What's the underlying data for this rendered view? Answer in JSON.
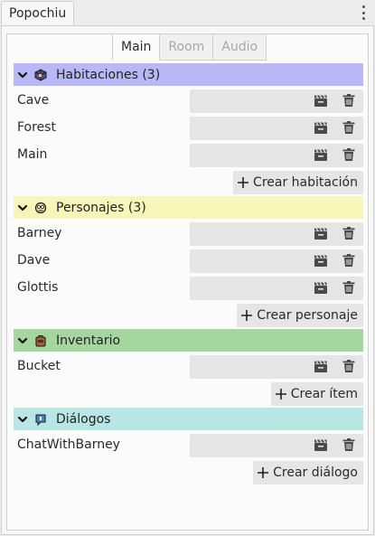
{
  "dock": {
    "title": "Popochiu"
  },
  "tabs": [
    {
      "label": "Main",
      "active": true
    },
    {
      "label": "Room",
      "active": false
    },
    {
      "label": "Audio",
      "active": false
    }
  ],
  "sections": [
    {
      "key": "rooms",
      "title": "Habitaciones (3)",
      "color": "#b8b8f6",
      "icon": "room-icon",
      "items": [
        "Cave",
        "Forest",
        "Main"
      ],
      "create_label": "Crear habitación"
    },
    {
      "key": "characters",
      "title": "Personajes (3)",
      "color": "#f6f6b8",
      "icon": "character-icon",
      "items": [
        "Barney",
        "Dave",
        "Glottis"
      ],
      "create_label": "Crear personaje"
    },
    {
      "key": "inventory",
      "title": "Inventario",
      "color": "#a6d6a0",
      "icon": "inventory-icon",
      "items": [
        "Bucket"
      ],
      "create_label": "Crear ítem"
    },
    {
      "key": "dialogs",
      "title": "Diálogos",
      "color": "#b8e6e2",
      "icon": "dialog-icon",
      "items": [
        "ChatWithBarney"
      ],
      "create_label": "Crear diálogo"
    }
  ]
}
